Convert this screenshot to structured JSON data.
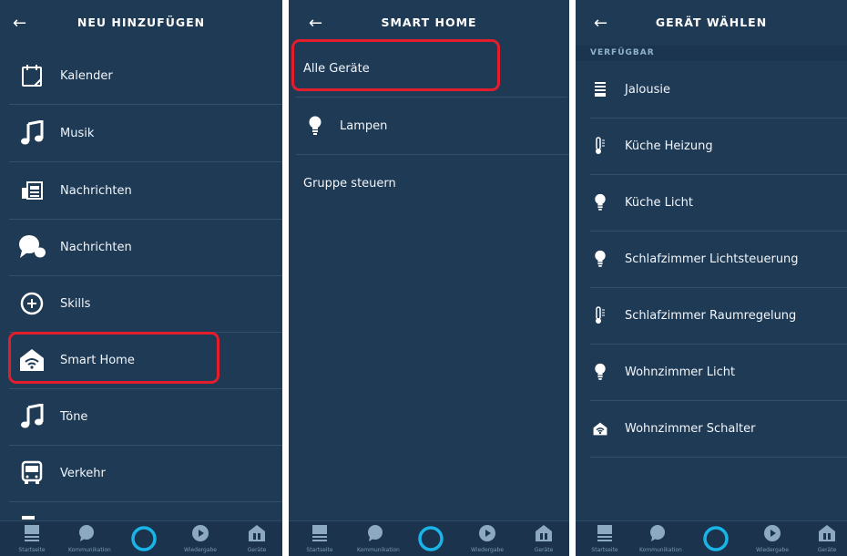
{
  "colors": {
    "panel": "#1f3a55",
    "divider": "#30506f",
    "highlight": "#e41d2d",
    "alexa_ring": "#1ab5e8"
  },
  "back_glyph": "←",
  "screen1": {
    "title": "NEU HINZUFÜGEN",
    "items": [
      {
        "label": "Kalender",
        "icon": "calendar-icon"
      },
      {
        "label": "Musik",
        "icon": "music-note-icon"
      },
      {
        "label": "Nachrichten",
        "icon": "newspaper-icon"
      },
      {
        "label": "Nachrichten",
        "icon": "chat-bubbles-icon"
      },
      {
        "label": "Skills",
        "icon": "skills-plus-icon"
      },
      {
        "label": "Smart Home",
        "icon": "smart-home-icon"
      },
      {
        "label": "Töne",
        "icon": "music-note-icon"
      },
      {
        "label": "Verkehr",
        "icon": "bus-icon"
      }
    ]
  },
  "screen2": {
    "title": "SMART HOME",
    "items": [
      {
        "label": "Alle Geräte"
      },
      {
        "label": "Lampen",
        "icon": "bulb-icon"
      },
      {
        "label": "Gruppe steuern"
      }
    ]
  },
  "screen3": {
    "title": "GERÄT WÄHLEN",
    "section": "VERFÜGBAR",
    "items": [
      {
        "label": "Jalousie",
        "icon": "blinds-icon"
      },
      {
        "label": "Küche Heizung",
        "icon": "thermometer-icon"
      },
      {
        "label": "Küche Licht",
        "icon": "bulb-icon"
      },
      {
        "label": "Schlafzimmer Lichtsteuerung",
        "icon": "bulb-icon"
      },
      {
        "label": "Schlafzimmer Raumregelung",
        "icon": "thermometer-icon"
      },
      {
        "label": "Wohnzimmer Licht",
        "icon": "bulb-icon"
      },
      {
        "label": "Wohnzimmer Schalter",
        "icon": "smart-home-icon"
      }
    ]
  },
  "nav": {
    "tabs": [
      {
        "label": "Startseite",
        "icon": "home-feed-icon"
      },
      {
        "label": "Kommunikation",
        "icon": "chat-icon"
      },
      {
        "label": "",
        "icon": "alexa-ring-icon"
      },
      {
        "label": "Wiedergabe",
        "icon": "play-icon"
      },
      {
        "label": "Geräte",
        "icon": "devices-icon"
      }
    ]
  }
}
